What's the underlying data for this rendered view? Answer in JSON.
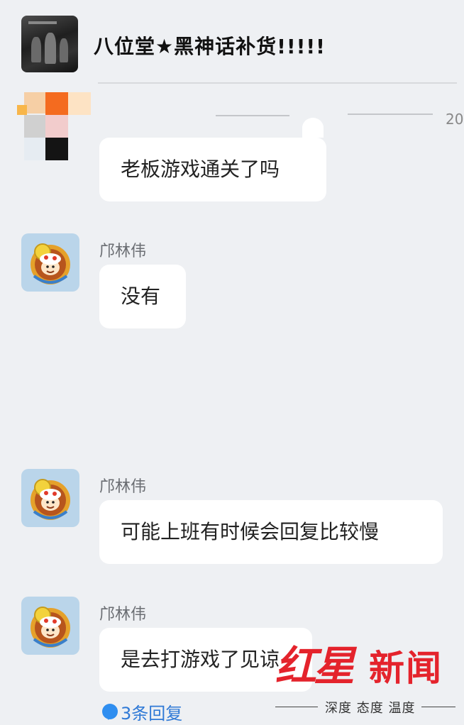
{
  "chat": {
    "title": "八位堂★黑神话补货!!!!!",
    "time_fragment": "20"
  },
  "messages": [
    {
      "sender": "",
      "text": "老板游戏通关了吗"
    },
    {
      "sender": "邝林伟",
      "text": "没有"
    },
    {
      "sender": "邝林伟",
      "text": "可能上班有时候会回复比较慢"
    },
    {
      "sender": "邝林伟",
      "text": "是去打游戏了见谅"
    }
  ],
  "thread": {
    "replies_label": "3条回复"
  },
  "watermark": {
    "brand_red": "红星",
    "brand_news": "新闻",
    "tagline": "深度 态度 温度"
  },
  "colors": {
    "background": "#eef0f3",
    "bubble": "#ffffff",
    "link_blue": "#2f79d6",
    "brand_red": "#e4232c"
  },
  "icons": [
    "group-avatar",
    "user-avatar-cartoon",
    "reply-bubble-icon"
  ]
}
